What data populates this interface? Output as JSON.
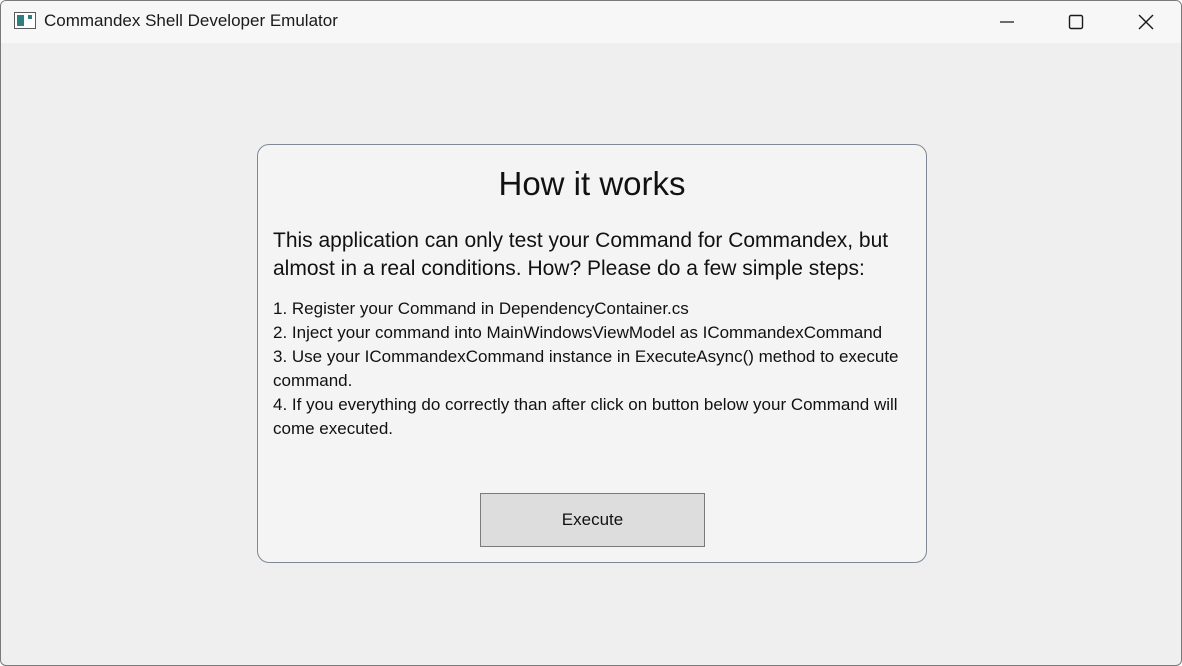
{
  "window": {
    "title": "Commandex Shell Developer Emulator",
    "icon": "app-window-icon",
    "controls": {
      "minimize_icon": "minimize-icon",
      "maximize_icon": "maximize-icon",
      "close_icon": "close-icon"
    }
  },
  "card": {
    "title": "How it works",
    "intro": "This application can only test your Command for Commandex, but almost in a real conditions. How? Please do a few simple steps:",
    "steps": [
      "1. Register your Command in DependencyContainer.cs",
      "2. Inject your command into MainWindowsViewModel as ICommandexCommand",
      "3. Use your ICommandexCommand instance in ExecuteAsync() method to execute command.",
      "4. If you everything do correctly than after click on button below your Command will come executed."
    ],
    "execute_label": "Execute"
  },
  "colors": {
    "window_background": "#efefef",
    "card_border": "#7f8894",
    "button_background": "#dddddd",
    "icon_accent": "#2f7f80"
  }
}
